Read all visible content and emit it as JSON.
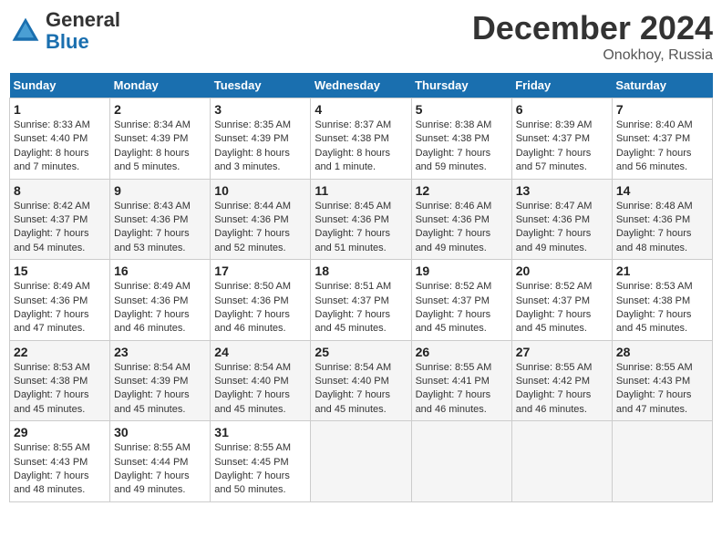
{
  "header": {
    "logo_line1": "General",
    "logo_line2": "Blue",
    "month": "December 2024",
    "location": "Onokhoy, Russia"
  },
  "days_of_week": [
    "Sunday",
    "Monday",
    "Tuesday",
    "Wednesday",
    "Thursday",
    "Friday",
    "Saturday"
  ],
  "weeks": [
    [
      {
        "day": "1",
        "detail": "Sunrise: 8:33 AM\nSunset: 4:40 PM\nDaylight: 8 hours\nand 7 minutes."
      },
      {
        "day": "2",
        "detail": "Sunrise: 8:34 AM\nSunset: 4:39 PM\nDaylight: 8 hours\nand 5 minutes."
      },
      {
        "day": "3",
        "detail": "Sunrise: 8:35 AM\nSunset: 4:39 PM\nDaylight: 8 hours\nand 3 minutes."
      },
      {
        "day": "4",
        "detail": "Sunrise: 8:37 AM\nSunset: 4:38 PM\nDaylight: 8 hours\nand 1 minute."
      },
      {
        "day": "5",
        "detail": "Sunrise: 8:38 AM\nSunset: 4:38 PM\nDaylight: 7 hours\nand 59 minutes."
      },
      {
        "day": "6",
        "detail": "Sunrise: 8:39 AM\nSunset: 4:37 PM\nDaylight: 7 hours\nand 57 minutes."
      },
      {
        "day": "7",
        "detail": "Sunrise: 8:40 AM\nSunset: 4:37 PM\nDaylight: 7 hours\nand 56 minutes."
      }
    ],
    [
      {
        "day": "8",
        "detail": "Sunrise: 8:42 AM\nSunset: 4:37 PM\nDaylight: 7 hours\nand 54 minutes."
      },
      {
        "day": "9",
        "detail": "Sunrise: 8:43 AM\nSunset: 4:36 PM\nDaylight: 7 hours\nand 53 minutes."
      },
      {
        "day": "10",
        "detail": "Sunrise: 8:44 AM\nSunset: 4:36 PM\nDaylight: 7 hours\nand 52 minutes."
      },
      {
        "day": "11",
        "detail": "Sunrise: 8:45 AM\nSunset: 4:36 PM\nDaylight: 7 hours\nand 51 minutes."
      },
      {
        "day": "12",
        "detail": "Sunrise: 8:46 AM\nSunset: 4:36 PM\nDaylight: 7 hours\nand 49 minutes."
      },
      {
        "day": "13",
        "detail": "Sunrise: 8:47 AM\nSunset: 4:36 PM\nDaylight: 7 hours\nand 49 minutes."
      },
      {
        "day": "14",
        "detail": "Sunrise: 8:48 AM\nSunset: 4:36 PM\nDaylight: 7 hours\nand 48 minutes."
      }
    ],
    [
      {
        "day": "15",
        "detail": "Sunrise: 8:49 AM\nSunset: 4:36 PM\nDaylight: 7 hours\nand 47 minutes."
      },
      {
        "day": "16",
        "detail": "Sunrise: 8:49 AM\nSunset: 4:36 PM\nDaylight: 7 hours\nand 46 minutes."
      },
      {
        "day": "17",
        "detail": "Sunrise: 8:50 AM\nSunset: 4:36 PM\nDaylight: 7 hours\nand 46 minutes."
      },
      {
        "day": "18",
        "detail": "Sunrise: 8:51 AM\nSunset: 4:37 PM\nDaylight: 7 hours\nand 45 minutes."
      },
      {
        "day": "19",
        "detail": "Sunrise: 8:52 AM\nSunset: 4:37 PM\nDaylight: 7 hours\nand 45 minutes."
      },
      {
        "day": "20",
        "detail": "Sunrise: 8:52 AM\nSunset: 4:37 PM\nDaylight: 7 hours\nand 45 minutes."
      },
      {
        "day": "21",
        "detail": "Sunrise: 8:53 AM\nSunset: 4:38 PM\nDaylight: 7 hours\nand 45 minutes."
      }
    ],
    [
      {
        "day": "22",
        "detail": "Sunrise: 8:53 AM\nSunset: 4:38 PM\nDaylight: 7 hours\nand 45 minutes."
      },
      {
        "day": "23",
        "detail": "Sunrise: 8:54 AM\nSunset: 4:39 PM\nDaylight: 7 hours\nand 45 minutes."
      },
      {
        "day": "24",
        "detail": "Sunrise: 8:54 AM\nSunset: 4:40 PM\nDaylight: 7 hours\nand 45 minutes."
      },
      {
        "day": "25",
        "detail": "Sunrise: 8:54 AM\nSunset: 4:40 PM\nDaylight: 7 hours\nand 45 minutes."
      },
      {
        "day": "26",
        "detail": "Sunrise: 8:55 AM\nSunset: 4:41 PM\nDaylight: 7 hours\nand 46 minutes."
      },
      {
        "day": "27",
        "detail": "Sunrise: 8:55 AM\nSunset: 4:42 PM\nDaylight: 7 hours\nand 46 minutes."
      },
      {
        "day": "28",
        "detail": "Sunrise: 8:55 AM\nSunset: 4:43 PM\nDaylight: 7 hours\nand 47 minutes."
      }
    ],
    [
      {
        "day": "29",
        "detail": "Sunrise: 8:55 AM\nSunset: 4:43 PM\nDaylight: 7 hours\nand 48 minutes."
      },
      {
        "day": "30",
        "detail": "Sunrise: 8:55 AM\nSunset: 4:44 PM\nDaylight: 7 hours\nand 49 minutes."
      },
      {
        "day": "31",
        "detail": "Sunrise: 8:55 AM\nSunset: 4:45 PM\nDaylight: 7 hours\nand 50 minutes."
      },
      {
        "day": "",
        "detail": ""
      },
      {
        "day": "",
        "detail": ""
      },
      {
        "day": "",
        "detail": ""
      },
      {
        "day": "",
        "detail": ""
      }
    ]
  ]
}
